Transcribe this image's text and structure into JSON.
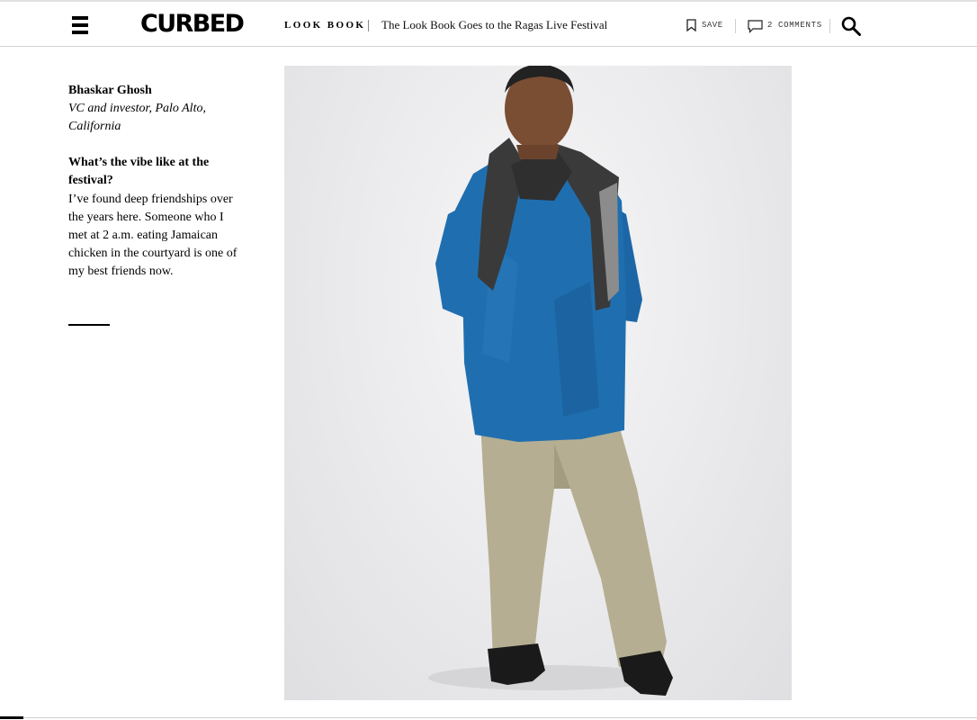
{
  "header": {
    "logo_text": "CURBED",
    "kicker": "LOOK BOOK",
    "story_title": "The Look Book Goes to the Ragas Live Festival",
    "save_label": "SAVE",
    "comments_count": "2",
    "comments_label": "COMMENTS",
    "icons": [
      "hamburger-menu-icon",
      "bookmark-icon",
      "comment-bubble-icon",
      "search-icon"
    ]
  },
  "profile": {
    "name": "Bhaskar Ghosh",
    "role": "VC and investor, Palo Alto, California",
    "question": "What’s the vibe like at the festival?",
    "answer": "I’ve found deep friendships over the years here. Someone who I met at 2 a.m. eating Jamaican chicken in the courtyard is one of my best friends now."
  },
  "colors": {
    "shirt_blue": "#1f6fb0",
    "pants_khaki": "#b5ae92",
    "scarf_gray": "#3a3a3a",
    "backdrop": "#ececee"
  }
}
